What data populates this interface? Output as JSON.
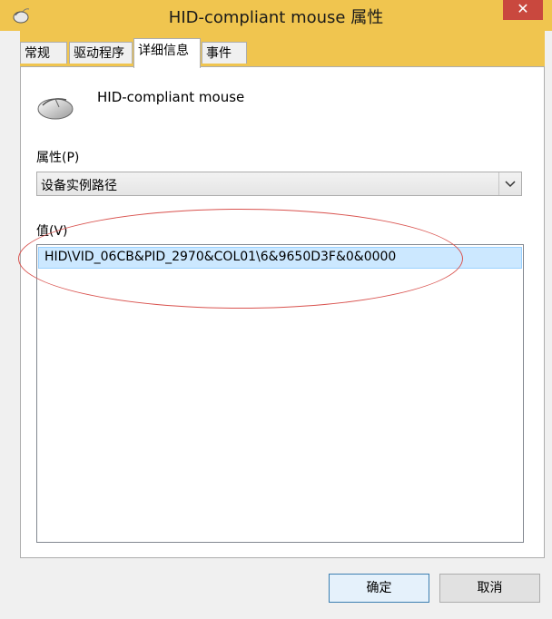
{
  "window": {
    "title": "HID-compliant mouse 属性",
    "close_label": "✕"
  },
  "tabs": [
    {
      "label": "常规",
      "active": false
    },
    {
      "label": "驱动程序",
      "active": false
    },
    {
      "label": "详细信息",
      "active": true
    },
    {
      "label": "事件",
      "active": false
    }
  ],
  "device": {
    "name": "HID-compliant mouse",
    "icon": "mouse-icon"
  },
  "property": {
    "label": "属性(P)",
    "selected": "设备实例路径"
  },
  "value": {
    "label": "值(V)",
    "items": [
      "HID\\VID_06CB&PID_2970&COL01\\6&9650D3F&0&0000"
    ]
  },
  "buttons": {
    "ok": "确定",
    "cancel": "取消"
  },
  "colors": {
    "titlebar": "#f0c54f",
    "close": "#c9483e",
    "selection": "#cce8ff",
    "annotation": "#d9534f"
  }
}
